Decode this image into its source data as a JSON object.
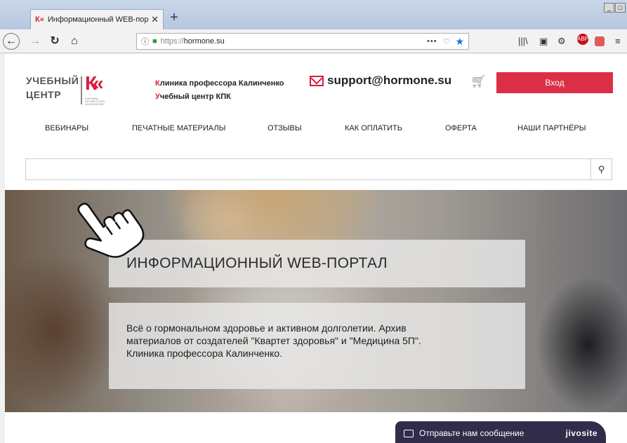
{
  "browser": {
    "tab_title": "Информационный WEB-портал, ",
    "favicon_text": "К«",
    "new_tab": "+",
    "url_prefix": "https://",
    "url_host": "hormone.su",
    "window_buttons": [
      "_",
      "□"
    ]
  },
  "header": {
    "logo_line1": "УЧЕБНЫЙ",
    "logo_line2": "ЦЕНТР",
    "logo_mark": "К«",
    "logo_small": "КЛИНИКА ПРОФЕССОРА КАЛИНЧЕНКО",
    "clinic_line1_first": "К",
    "clinic_line1_rest": "линика профессора Калинченко",
    "clinic_line2_first": "У",
    "clinic_line2_rest": "чебный центр КПК",
    "email": "support@hormone.su",
    "login_label": "Вход"
  },
  "menu": {
    "items": [
      {
        "label": "ВЕБИНАРЫ"
      },
      {
        "label": "ПЕЧАТНЫЕ МАТЕРИАЛЫ"
      },
      {
        "label": "ОТЗЫВЫ"
      },
      {
        "label": "КАК ОПЛАТИТЬ"
      },
      {
        "label": "ОФЕРТА"
      },
      {
        "label": "НАШИ ПАРТНЁРЫ"
      }
    ]
  },
  "search": {
    "value": "",
    "placeholder": ""
  },
  "hero": {
    "title": "ИНФОРМАЦИОННЫЙ WEB-ПОРТАЛ",
    "description_line1": "Всё о гормональном здоровье и активном долголетии. Архив",
    "description_line2": "материалов от создателей \"Квартет здоровья\" и \"Медицина 5П\".",
    "description_line3": "Клиника профессора Калинченко."
  },
  "chat": {
    "message": "Отправьте нам сообщение",
    "brand": "jivosite"
  },
  "colors": {
    "accent": "#dc2f46",
    "chat_bg": "#302c4a"
  }
}
